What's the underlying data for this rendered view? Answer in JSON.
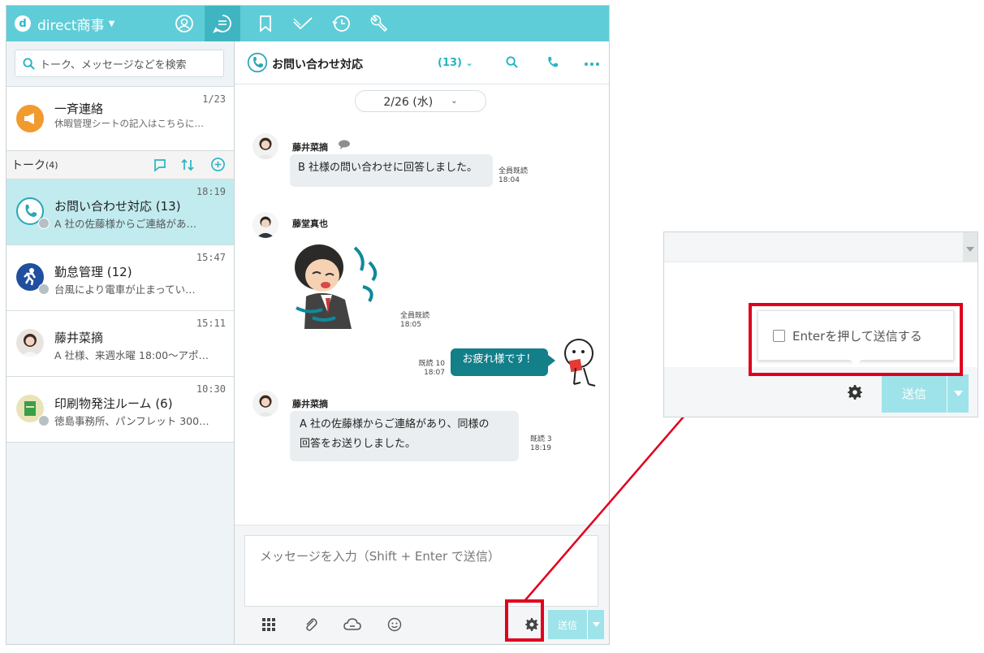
{
  "header": {
    "org_name": "direct商事"
  },
  "left": {
    "search_placeholder": "トーク、メッセージなどを検索",
    "announce": {
      "title": "一斉連絡",
      "preview": "休暇管理シートの記入はこちらに…",
      "date": "1/23"
    },
    "talk_header": {
      "label": "トーク",
      "count": "(4)"
    },
    "rooms": [
      {
        "name": "お問い合わせ対応 (13)",
        "preview": "A 社の佐藤様からご連絡があ…",
        "time": "18:19",
        "selected": true
      },
      {
        "name": "勤怠管理 (12)",
        "preview": "台風により電車が止まってい…",
        "time": "15:47"
      },
      {
        "name": "藤井菜摘",
        "preview": "A 社様、来週水曜 18:00〜アポ…",
        "time": "15:11"
      },
      {
        "name": "印刷物発注ルーム (6)",
        "preview": "徳島事務所、パンフレット 300…",
        "time": "10:30"
      }
    ]
  },
  "chat": {
    "title": "お問い合わせ対応",
    "member_count": "(13)",
    "date": "2/26 (水)",
    "messages": [
      {
        "sender": "藤井菜摘",
        "text": "B 社様の問い合わせに回答しました。",
        "read": "全員既読",
        "time": "18:04"
      },
      {
        "sender": "藤堂真也",
        "read": "全員既読",
        "time": "18:05"
      },
      {
        "text": "お疲れ様です！",
        "read": "既読 10",
        "time": "18:07"
      },
      {
        "sender": "藤井菜摘",
        "line1": "A 社の佐藤様からご連絡があり、同様の",
        "line2": "回答をお送りしました。",
        "read": "既読 3",
        "time": "18:19"
      }
    ],
    "input_placeholder": "メッセージを入力（Shift + Enter で送信）",
    "send_label": "送信"
  },
  "zoom": {
    "checkbox_label": "Enterを押して送信する",
    "send_label": "送信"
  },
  "colors": {
    "topbar": "#5fcdd8",
    "selected": "#c1ebef",
    "mine_bubble": "#127f89",
    "send": "#9ee3e9",
    "highlight": "#e0001e"
  }
}
